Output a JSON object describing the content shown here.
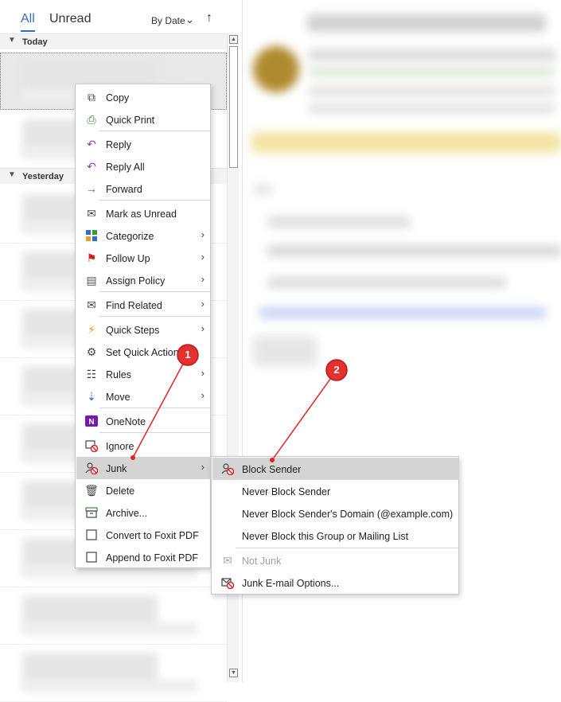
{
  "list": {
    "tab_all": "All",
    "tab_unread": "Unread",
    "sort_by": "By Date",
    "groups": {
      "today": "Today",
      "yesterday": "Yesterday"
    }
  },
  "context_menu": {
    "items": [
      {
        "label": "Copy",
        "icon": "copy-icon"
      },
      {
        "label": "Quick Print",
        "icon": "quick-print-icon"
      },
      {
        "label": "Reply",
        "icon": "reply-icon"
      },
      {
        "label": "Reply All",
        "icon": "reply-all-icon"
      },
      {
        "label": "Forward",
        "icon": "forward-icon"
      },
      {
        "label": "Mark as Unread",
        "icon": "envelope-icon"
      },
      {
        "label": "Categorize",
        "icon": "categorize-icon"
      },
      {
        "label": "Follow Up",
        "icon": "flag-icon"
      },
      {
        "label": "Assign Policy",
        "icon": "policy-icon"
      },
      {
        "label": "Find Related",
        "icon": "find-related-icon"
      },
      {
        "label": "Quick Steps",
        "icon": "lightning-icon"
      },
      {
        "label": "Set Quick Actions...",
        "icon": "gear-icon"
      },
      {
        "label": "Rules",
        "icon": "rules-icon"
      },
      {
        "label": "Move",
        "icon": "move-icon"
      },
      {
        "label": "OneNote",
        "icon": "onenote-icon"
      },
      {
        "label": "Ignore",
        "icon": "ignore-icon"
      },
      {
        "label": "Junk",
        "icon": "junk-icon"
      },
      {
        "label": "Delete",
        "icon": "trash-icon"
      },
      {
        "label": "Archive...",
        "icon": "archive-icon"
      },
      {
        "label": "Convert to Foxit PDF",
        "icon": "checkbox-icon"
      },
      {
        "label": "Append to Foxit PDF",
        "icon": "checkbox-icon"
      }
    ]
  },
  "junk_menu": {
    "items": [
      {
        "label": "Block Sender",
        "icon": "block-sender-icon"
      },
      {
        "label": "Never Block Sender"
      },
      {
        "label": "Never Block Sender's Domain (@example.com)"
      },
      {
        "label": "Never Block this Group or Mailing List"
      },
      {
        "label": "Not Junk",
        "icon": "envelope-icon"
      },
      {
        "label": "Junk E-mail Options...",
        "icon": "junk-options-icon"
      }
    ]
  },
  "callouts": {
    "one": "1",
    "two": "2"
  },
  "colors": {
    "accent": "#2f6fc1",
    "callout": "#e02424",
    "highlight": "#d4d4d4"
  }
}
